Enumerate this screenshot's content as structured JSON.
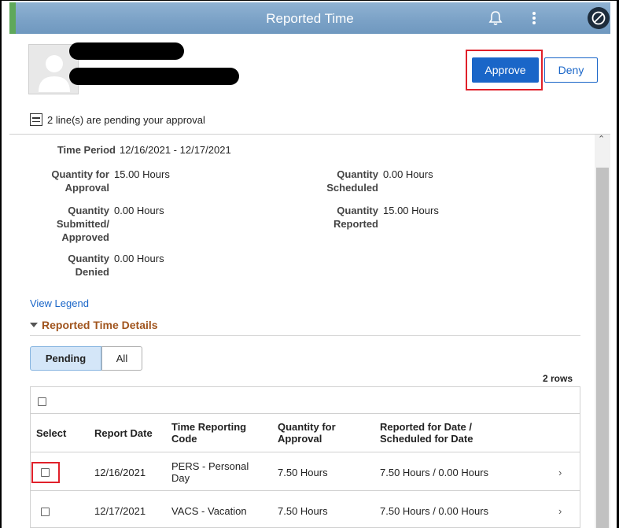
{
  "header": {
    "title": "Reported Time",
    "approve_label": "Approve",
    "deny_label": "Deny",
    "pending_text": "2 line(s) are pending your approval"
  },
  "summary": {
    "time_period_label": "Time Period",
    "time_period_value": "12/16/2021 - 12/17/2021",
    "qty_approval_label_1": "Quantity for",
    "qty_approval_label_2": "Approval",
    "qty_approval_value": "15.00 Hours",
    "qty_scheduled_label_1": "Quantity",
    "qty_scheduled_label_2": "Scheduled",
    "qty_scheduled_value": "0.00 Hours",
    "qty_submitted_label_1": "Quantity",
    "qty_submitted_label_2": "Submitted/",
    "qty_submitted_label_3": "Approved",
    "qty_submitted_value": "0.00 Hours",
    "qty_reported_label_1": "Quantity",
    "qty_reported_label_2": "Reported",
    "qty_reported_value": "15.00 Hours",
    "qty_denied_label_1": "Quantity",
    "qty_denied_label_2": "Denied",
    "qty_denied_value": "0.00 Hours"
  },
  "view_legend": "View Legend",
  "details": {
    "section_title": "Reported Time Details",
    "tab_pending": "Pending",
    "tab_all": "All",
    "rows_count": "2 rows",
    "columns": {
      "select": "Select",
      "report_date": "Report Date",
      "trc_1": "Time Reporting",
      "trc_2": "Code",
      "qty_1": "Quantity for",
      "qty_2": "Approval",
      "rep_1": "Reported for Date /",
      "rep_2": "Scheduled for Date"
    },
    "rows": [
      {
        "report_date": "12/16/2021",
        "trc_1": "PERS - Personal",
        "trc_2": "Day",
        "qty": "7.50 Hours",
        "reported": "7.50 Hours / 0.00 Hours"
      },
      {
        "report_date": "12/17/2021",
        "trc_1": "VACS - Vacation",
        "trc_2": "",
        "qty": "7.50 Hours",
        "reported": "7.50 Hours / 0.00 Hours"
      }
    ]
  },
  "colors": {
    "topbar": "#7aa1c6",
    "approve": "#1a66c8",
    "section_title": "#a0541d",
    "highlight": "#e0202a"
  }
}
